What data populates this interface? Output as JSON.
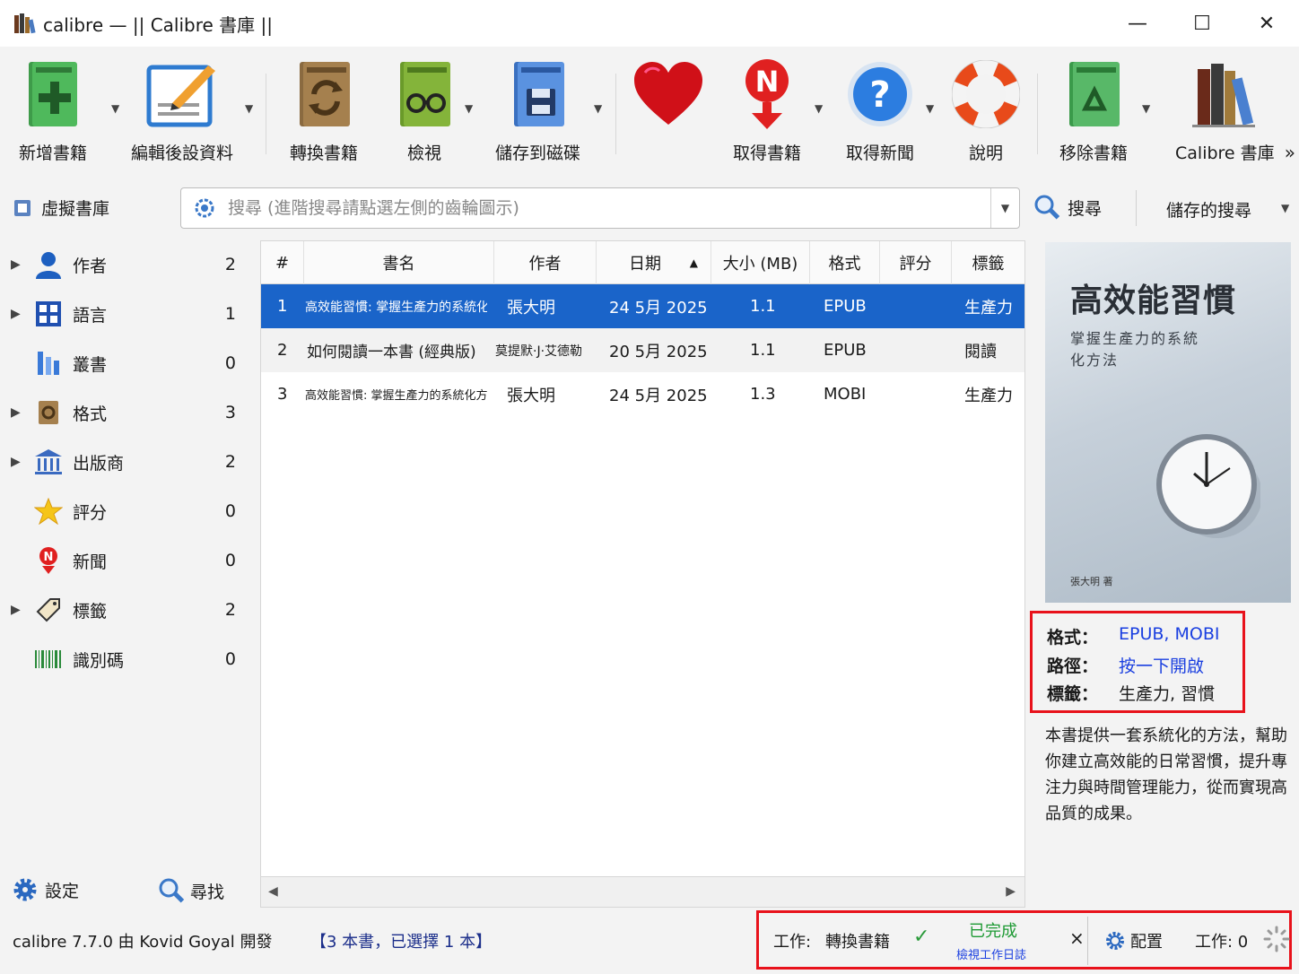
{
  "window": {
    "title": "calibre — || Calibre 書庫 ||",
    "minimize": "—",
    "maximize": "☐",
    "close": "✕"
  },
  "toolbar": {
    "add_books": "新增書籍",
    "edit_metadata": "編輯後設資料",
    "convert_books": "轉換書籍",
    "view": "檢視",
    "save_to_disk": "儲存到磁碟",
    "fetch_books": "取得書籍",
    "fetch_news": "取得新聞",
    "help": "說明",
    "remove_books": "移除書籍",
    "library": "Calibre 書庫",
    "more": "»"
  },
  "search": {
    "virtual_library": "虛擬書庫",
    "placeholder": "搜尋 (進階搜尋請點選左側的齒輪圖示)",
    "search_button": "搜尋",
    "saved_searches": "儲存的搜尋"
  },
  "tag_browser": {
    "items": [
      {
        "label": "作者",
        "count": "2"
      },
      {
        "label": "語言",
        "count": "1"
      },
      {
        "label": "叢書",
        "count": "0"
      },
      {
        "label": "格式",
        "count": "3"
      },
      {
        "label": "出版商",
        "count": "2"
      },
      {
        "label": "評分",
        "count": "0"
      },
      {
        "label": "新聞",
        "count": "0"
      },
      {
        "label": "標籤",
        "count": "2"
      },
      {
        "label": "識別碼",
        "count": "0"
      }
    ],
    "settings": "設定",
    "find": "尋找"
  },
  "table": {
    "headers": {
      "num": "#",
      "title": "書名",
      "author": "作者",
      "date": "日期",
      "size": "大小 (MB)",
      "format": "格式",
      "rating": "評分",
      "tags": "標籤"
    },
    "rows": [
      {
        "num": "1",
        "title": "高效能習慣: 掌握生產力的系統化方法",
        "author": "張大明",
        "date": "24 5月 2025",
        "size": "1.1",
        "format": "EPUB",
        "rating": "",
        "tags": "生產力"
      },
      {
        "num": "2",
        "title": "如何閱讀一本書 (經典版)",
        "author": "莫提默·J·艾德勒",
        "date": "20 5月 2025",
        "size": "1.1",
        "format": "EPUB",
        "rating": "",
        "tags": "閱讀"
      },
      {
        "num": "3",
        "title": "高效能習慣: 掌握生產力的系統化方法",
        "author": "張大明",
        "date": "24 5月 2025",
        "size": "1.3",
        "format": "MOBI",
        "rating": "",
        "tags": "生產力"
      }
    ]
  },
  "details": {
    "cover_title": "高效能習慣",
    "cover_subtitle": "掌握生產力的系統化方法",
    "cover_author": "張大明 著",
    "formats_label": "格式：",
    "formats_value": "EPUB, MOBI",
    "path_label": "路徑：",
    "path_value": "按一下開啟",
    "tags_label": "標籤：",
    "tags_value": "生產力, 習慣",
    "description": "本書提供一套系統化的方法，幫助你建立高效能的日常習慣，提升專注力與時間管理能力，從而實現高品質的成果。"
  },
  "status": {
    "version": "calibre 7.7.0 由 Kovid Goyal 開發",
    "count": "【3 本書，已選擇 1 本】",
    "job_label": "工作:",
    "job_name": "轉換書籍",
    "job_check": "✓",
    "job_done": "已完成",
    "job_log": "檢視工作日誌",
    "job_close": "×",
    "configure": "配置",
    "jobs_count": "工作: 0"
  },
  "colors": {
    "selection": "#1a64c9",
    "highlight_border": "#e8121b",
    "link": "#1a3fe0",
    "success": "#1e9a34"
  },
  "icons": [
    "add-book-icon",
    "edit-metadata-icon",
    "convert-icon",
    "view-icon",
    "save-disk-icon",
    "heart-icon",
    "news-fetch-icon",
    "help-icon",
    "lifebuoy-icon",
    "remove-book-icon",
    "library-icon",
    "gear-icon",
    "search-icon",
    "user-icon",
    "language-icon",
    "series-icon",
    "format-icon",
    "publisher-icon",
    "star-icon",
    "news-icon",
    "tag-icon",
    "barcode-icon"
  ]
}
